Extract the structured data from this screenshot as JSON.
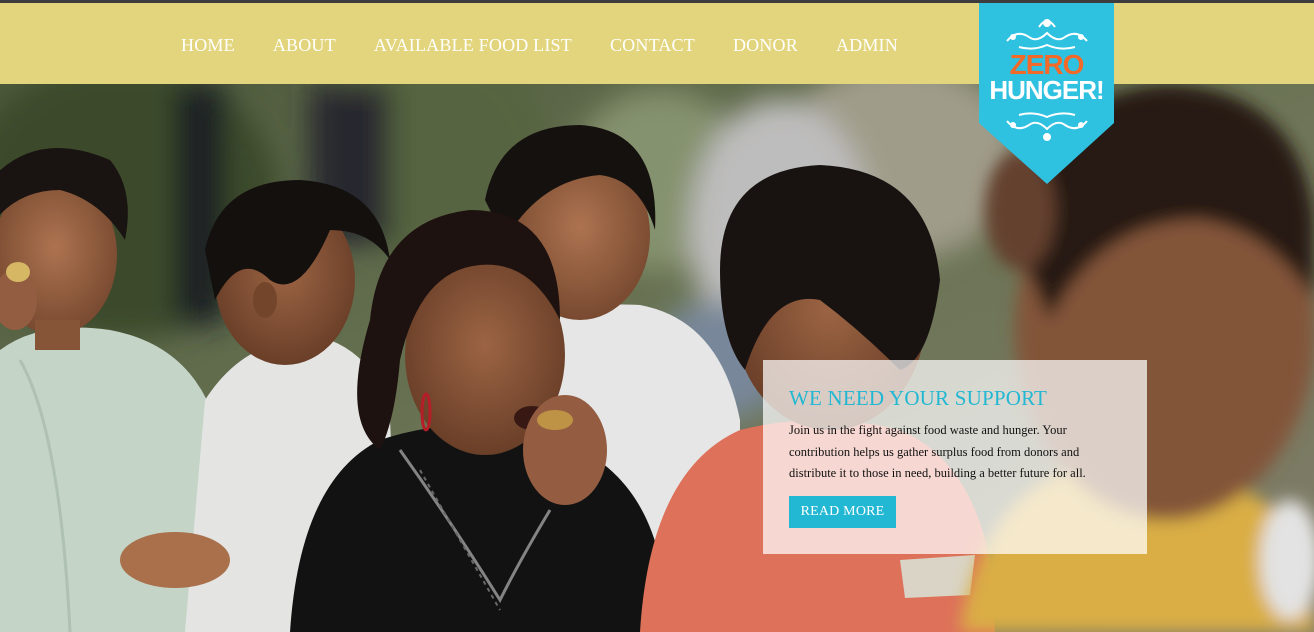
{
  "nav": {
    "items": [
      {
        "label": "HOME"
      },
      {
        "label": "ABOUT"
      },
      {
        "label": "AVAILABLE FOOD LIST"
      },
      {
        "label": "CONTACT"
      },
      {
        "label": "DONOR"
      },
      {
        "label": "ADMIN"
      }
    ]
  },
  "logo": {
    "line1": "ZERO",
    "line2": "HUNGER!"
  },
  "card": {
    "title": "WE NEED YOUR SUPPORT",
    "body": "Join us in the fight against food waste and hunger. Your contribution helps us gather surplus food from donors and distribute it to those in need, building a better future for all.",
    "button": "READ MORE"
  },
  "colors": {
    "header_bg": "#e3d57d",
    "accent": "#22b7d2",
    "logo_orange": "#f26a2a"
  }
}
